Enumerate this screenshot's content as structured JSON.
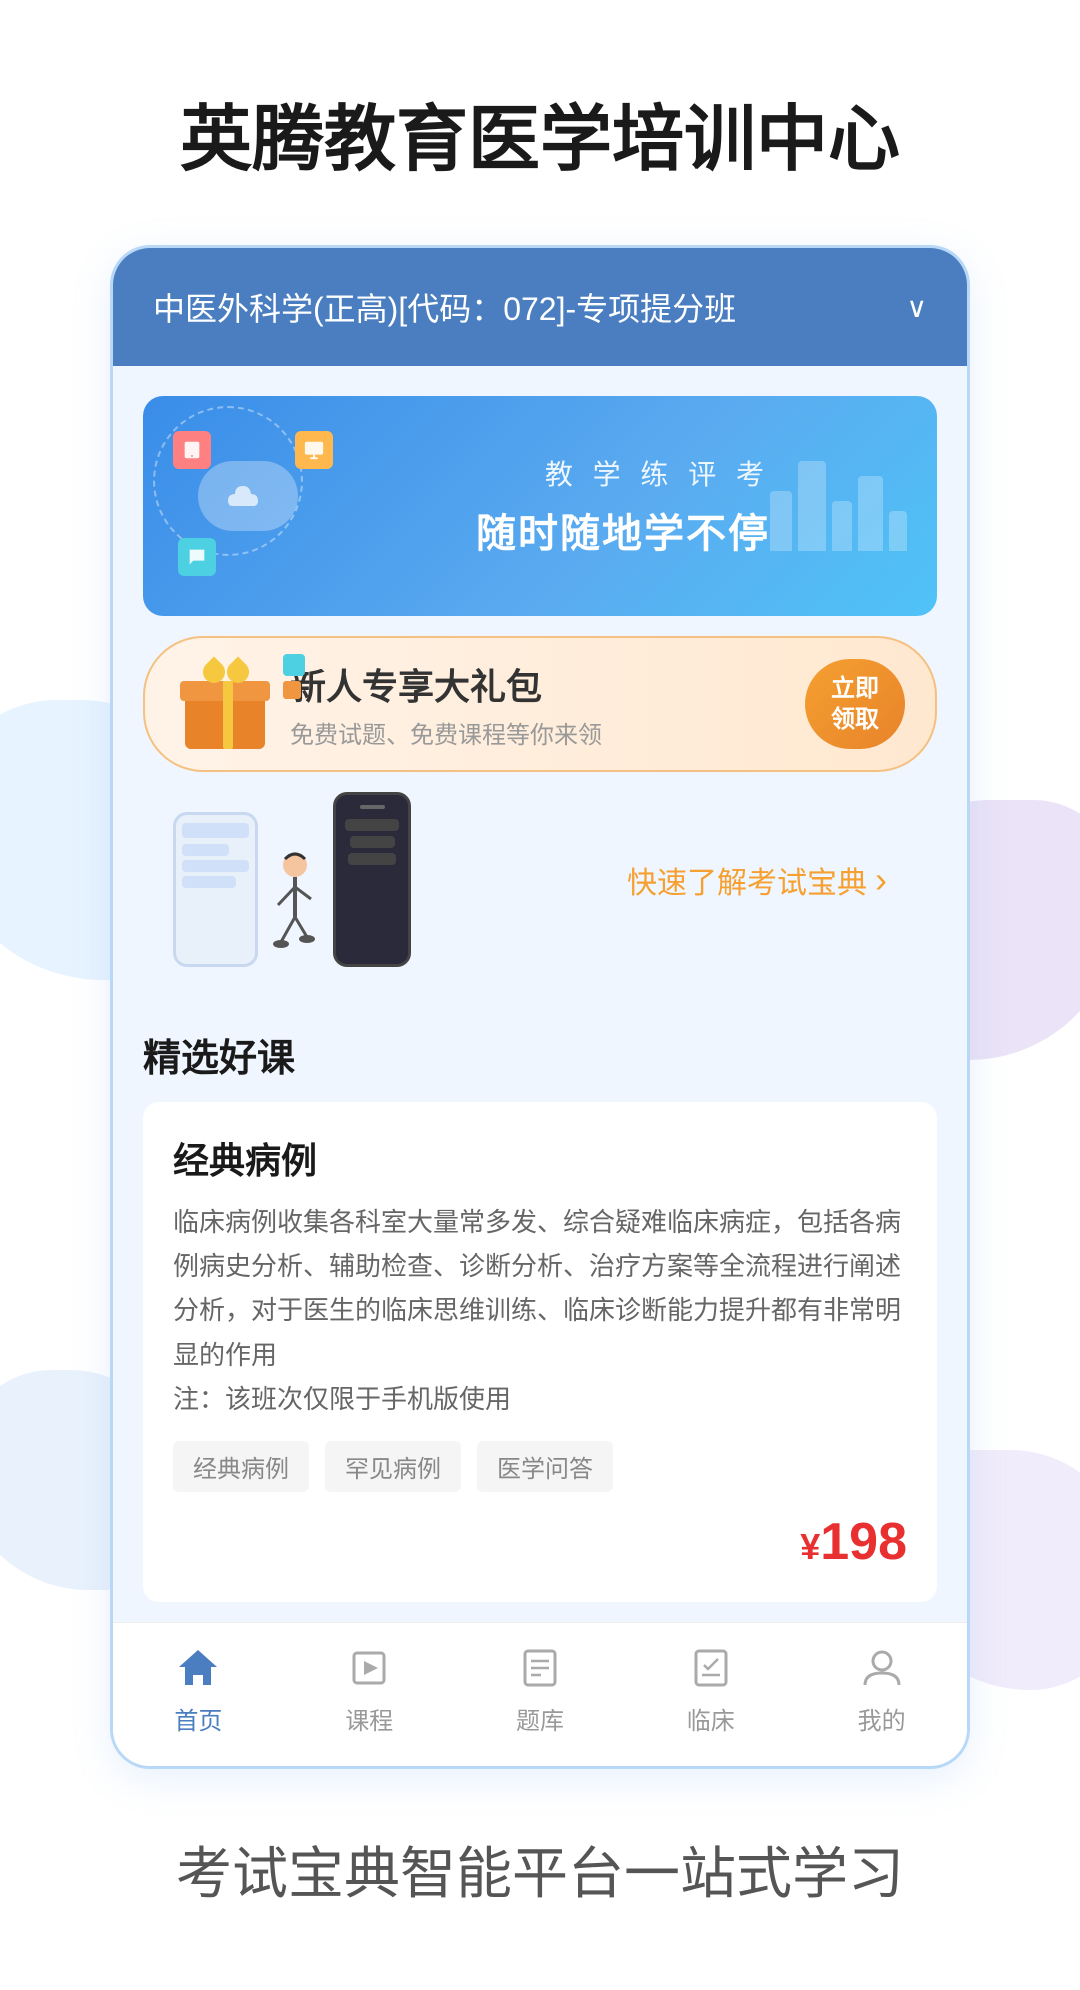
{
  "app": {
    "title": "英腾教育医学培训中心",
    "bottom_tagline": "考试宝典智能平台一站式学习"
  },
  "course_header": {
    "text": "中医外科学(正高)[代码：072]-专项提分班",
    "chevron": "∨"
  },
  "banner": {
    "subtitle": "教 学 练 评 考",
    "title": "随时随地学不停"
  },
  "gift_banner": {
    "title": "新人专享大礼包",
    "subtitle": "免费试题、免费课程等你来领",
    "button_line1": "立即",
    "button_line2": "领取"
  },
  "exam_guide": {
    "link_text": "快速了解考试宝典",
    "arrow": "›"
  },
  "selected_courses": {
    "section_title": "精选好课",
    "course": {
      "title": "经典病例",
      "description": "临床病例收集各科室大量常多发、综合疑难临床病症，包括各病例病史分析、辅助检查、诊断分析、治疗方案等全流程进行阐述分析，对于医生的临床思维训练、临床诊断能力提升都有非常明显的作用\n注：该班次仅限于手机版使用",
      "tags": [
        "经典病例",
        "罕见病例",
        "医学问答"
      ],
      "price_symbol": "¥",
      "price": "198"
    }
  },
  "bottom_nav": {
    "items": [
      {
        "label": "首页",
        "icon": "home-icon",
        "active": true
      },
      {
        "label": "课程",
        "icon": "course-icon",
        "active": false
      },
      {
        "label": "题库",
        "icon": "question-bank-icon",
        "active": false
      },
      {
        "label": "临床",
        "icon": "clinical-icon",
        "active": false
      },
      {
        "label": "我的",
        "icon": "profile-icon",
        "active": false
      }
    ]
  },
  "colors": {
    "primary": "#4a7ec0",
    "accent_orange": "#f5a030",
    "price_red": "#e83030",
    "text_dark": "#1a1a1a",
    "text_gray": "#666666"
  }
}
